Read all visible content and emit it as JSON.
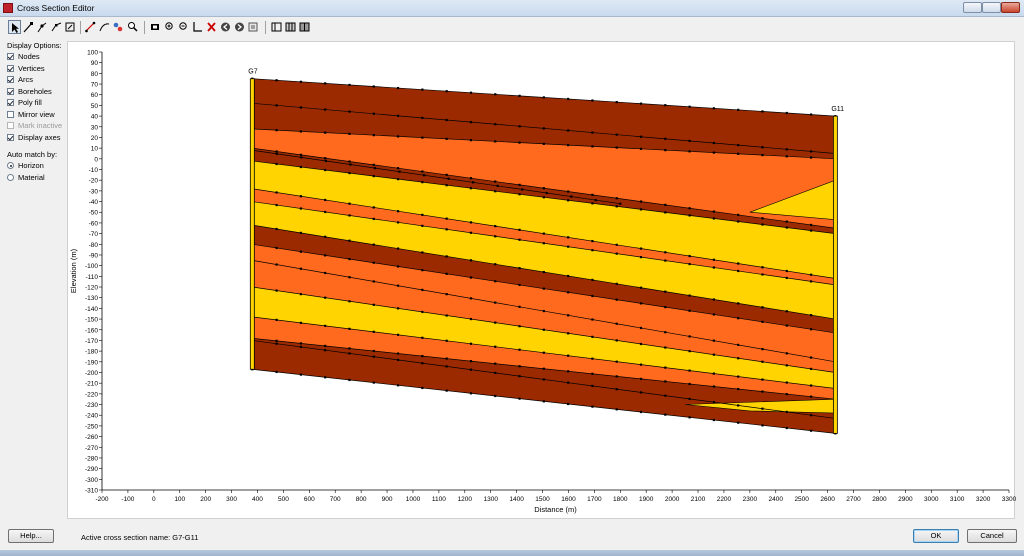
{
  "window": {
    "title": "Cross Section Editor"
  },
  "toolbar": {
    "tools": [
      "select-arrow-icon",
      "select-vertex-icon",
      "create-node-icon",
      "create-vertex-icon",
      "frame-icon",
      "create-arc-icon",
      "redistribute-icon",
      "connect-icon",
      "zoom-icon",
      "pan-icon",
      "zoom-in-icon",
      "zoom-out-icon",
      "axis-icon",
      "delete-icon",
      "previous-icon",
      "next-icon",
      "export-icon",
      "layout-1-icon",
      "layout-2-icon",
      "layout-3-icon"
    ]
  },
  "display_options": {
    "heading": "Display Options:",
    "items": [
      {
        "label": "Nodes",
        "checked": true,
        "enabled": true
      },
      {
        "label": "Vertices",
        "checked": true,
        "enabled": true
      },
      {
        "label": "Arcs",
        "checked": true,
        "enabled": true
      },
      {
        "label": "Boreholes",
        "checked": true,
        "enabled": true
      },
      {
        "label": "Poly fill",
        "checked": true,
        "enabled": true
      },
      {
        "label": "Mirror view",
        "checked": false,
        "enabled": true
      },
      {
        "label": "Mark inactive",
        "checked": false,
        "enabled": false
      },
      {
        "label": "Display axes",
        "checked": true,
        "enabled": true
      }
    ]
  },
  "auto_match": {
    "heading": "Auto match by:",
    "options": [
      {
        "label": "Horizon",
        "selected": true
      },
      {
        "label": "Material",
        "selected": false
      }
    ]
  },
  "status": {
    "active_label": "Active cross section name:",
    "active_value": "G7-G11"
  },
  "buttons": {
    "help": "Help...",
    "ok": "OK",
    "cancel": "Cancel"
  },
  "colors": {
    "dark_layer": "#9c2a00",
    "mid_layer": "#ff6a1f",
    "light_layer": "#ffd400"
  },
  "chart_data": {
    "type": "cross-section",
    "xlabel": "Distance (m)",
    "ylabel": "Elevation (m)",
    "xlim": [
      -200,
      3300
    ],
    "ylim": [
      -310,
      100
    ],
    "x_ticks": [
      -200,
      -100,
      0,
      100,
      200,
      300,
      400,
      500,
      600,
      700,
      800,
      900,
      1000,
      1100,
      1200,
      1300,
      1400,
      1500,
      1600,
      1700,
      1800,
      1900,
      2000,
      2100,
      2200,
      2300,
      2400,
      2500,
      2600,
      2700,
      2800,
      2900,
      3000,
      3100,
      3200,
      3300
    ],
    "y_ticks": [
      100,
      90,
      80,
      70,
      60,
      50,
      40,
      30,
      20,
      10,
      0,
      -10,
      -20,
      -30,
      -40,
      -50,
      -60,
      -70,
      -80,
      -90,
      -100,
      -110,
      -120,
      -130,
      -140,
      -150,
      -160,
      -170,
      -180,
      -190,
      -200,
      -210,
      -220,
      -230,
      -240,
      -250,
      -260,
      -270,
      -280,
      -290,
      -300,
      -310
    ],
    "boreholes": [
      {
        "name": "G7",
        "x": 380,
        "top": 75,
        "bottom": -197
      },
      {
        "name": "G11",
        "x": 2630,
        "top": 40,
        "bottom": -257
      }
    ],
    "layers": [
      {
        "color": "dark",
        "top": [
          75,
          40
        ],
        "bottom": [
          52,
          5
        ]
      },
      {
        "color": "dark",
        "top": [
          52,
          5
        ],
        "bottom": [
          28,
          0
        ]
      },
      {
        "color": "mid",
        "top": [
          28,
          0
        ],
        "bottom": [
          10,
          -65
        ]
      },
      {
        "color": "dark",
        "top": [
          10,
          -65
        ],
        "bottom": [
          -2,
          -70
        ]
      },
      {
        "color": "light",
        "top": [
          -2,
          -70
        ],
        "bottom": [
          -28,
          -112
        ]
      },
      {
        "color": "mid",
        "top": [
          -28,
          -112
        ],
        "bottom": [
          -40,
          -118
        ]
      },
      {
        "color": "light",
        "top": [
          -40,
          -118
        ],
        "bottom": [
          -62,
          -150
        ]
      },
      {
        "color": "dark",
        "top": [
          -62,
          -150
        ],
        "bottom": [
          -80,
          -163
        ]
      },
      {
        "color": "mid",
        "top": [
          -80,
          -163
        ],
        "bottom": [
          -120,
          -200
        ]
      },
      {
        "color": "light",
        "top": [
          -120,
          -200
        ],
        "bottom": [
          -148,
          -215
        ]
      },
      {
        "color": "mid",
        "top": [
          -148,
          -215
        ],
        "bottom": [
          -168,
          -225
        ]
      },
      {
        "color": "dark",
        "top": [
          -168,
          -225
        ],
        "bottom": [
          -197,
          -257
        ]
      }
    ],
    "lenses": [
      {
        "color": "light",
        "points": [
          [
            2300,
            -50
          ],
          [
            2630,
            -20
          ],
          [
            2630,
            -57
          ],
          [
            2400,
            -52
          ]
        ]
      },
      {
        "color": "light",
        "points": [
          [
            2050,
            -230
          ],
          [
            2630,
            -225
          ],
          [
            2630,
            -238
          ],
          [
            2300,
            -236
          ]
        ]
      }
    ],
    "extra_arcs": [
      [
        [
          380,
          -95
        ],
        [
          2630,
          -190
        ]
      ],
      [
        [
          380,
          -170
        ],
        [
          2630,
          -243
        ]
      ],
      [
        [
          380,
          8
        ],
        [
          1800,
          -42
        ]
      ]
    ]
  }
}
